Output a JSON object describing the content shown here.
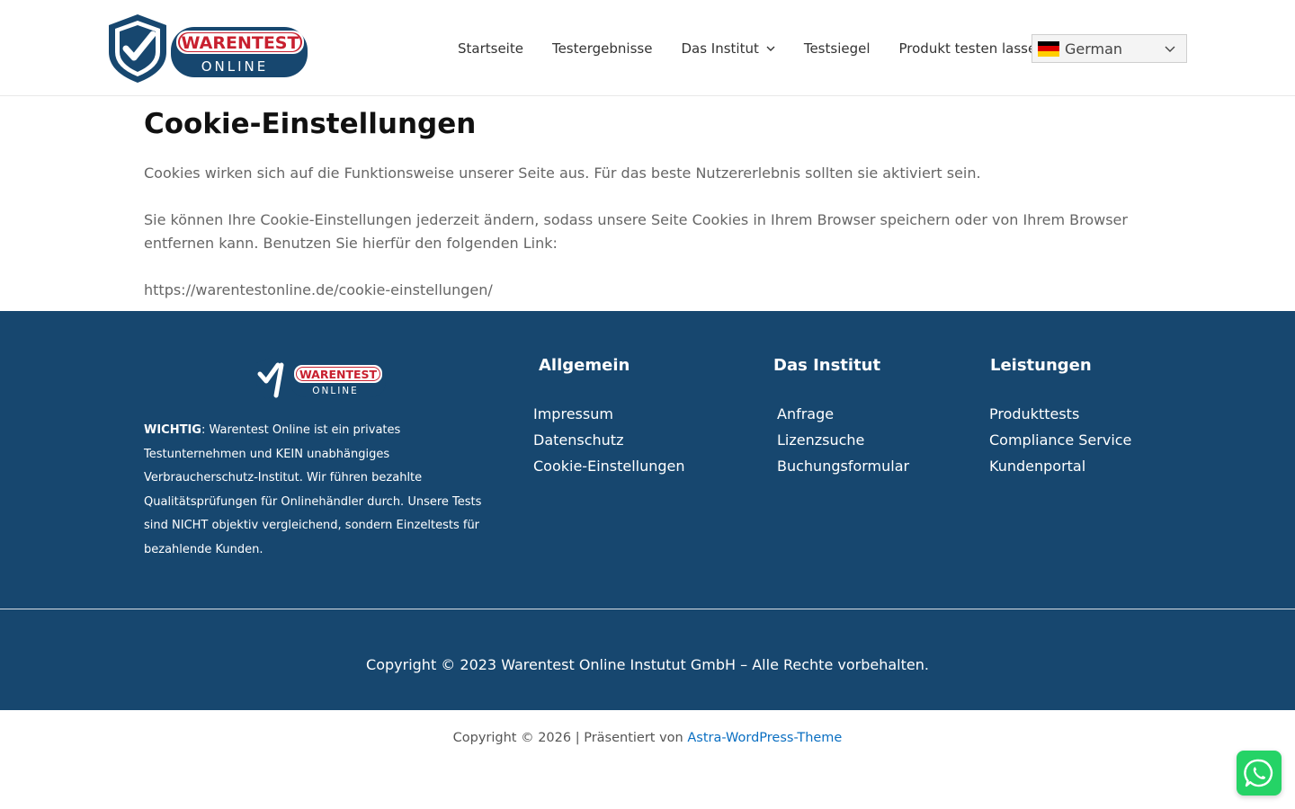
{
  "header": {
    "logo_top": "WARENTEST",
    "logo_bottom": "ONLINE",
    "nav": [
      {
        "label": "Startseite"
      },
      {
        "label": "Testergebnisse"
      },
      {
        "label": "Das Institut",
        "has_dropdown": true
      },
      {
        "label": "Testsiegel"
      },
      {
        "label": "Produkt testen lassen"
      }
    ],
    "language": {
      "selected": "German",
      "flag": "de-flag-icon"
    }
  },
  "main": {
    "title": "Cookie-Einstellungen",
    "paragraphs": [
      "Cookies wirken sich auf die Funktionsweise unserer Seite aus. Für das beste Nutzererlebnis sollten sie aktiviert sein.",
      "Sie können Ihre Cookie-Einstellungen jederzeit ändern, sodass unsere Seite Cookies in Ihrem Browser speichern oder von Ihrem Browser entfernen kann. Benutzen Sie hierfür den folgenden Link:",
      "https://warentestonline.de/cookie-einstellungen/"
    ]
  },
  "footer": {
    "logo_top": "WARENTEST",
    "logo_bottom": "ONLINE",
    "note_bold": "WICHTIG",
    "note_text": ": Warentest Online ist ein privates Testunternehmen und KEIN unabhängiges Verbraucherschutz-Institut. Wir führen bezahlte Qualitätsprüfungen für Onlinehändler durch. Unsere Tests sind NICHT objektiv vergleichend, sondern Einzeltests für bezahlende Kunden.",
    "columns": [
      {
        "title": "Allgemein",
        "links": [
          "Impressum",
          "Datenschutz",
          "Cookie-Einstellungen"
        ]
      },
      {
        "title": "Das Institut",
        "links": [
          "Anfrage",
          "Lizenzsuche",
          "Buchungsformular"
        ]
      },
      {
        "title": "Leistungen",
        "links": [
          "Produkttests",
          "Compliance Service",
          "Kundenportal"
        ]
      }
    ],
    "copyright": "Copyright © 2023 Warentest Online Instutut GmbH – Alle Rechte vorbehalten."
  },
  "site_info": {
    "prefix": "Copyright © 2026 | Präsentiert von ",
    "link": "Astra-WordPress-Theme"
  },
  "colors": {
    "footer_bg": "#17476f",
    "link_blue": "#0a6fc2",
    "whatsapp_green": "#25d366",
    "logo_red": "#c8202f",
    "logo_blue": "#17476f"
  }
}
